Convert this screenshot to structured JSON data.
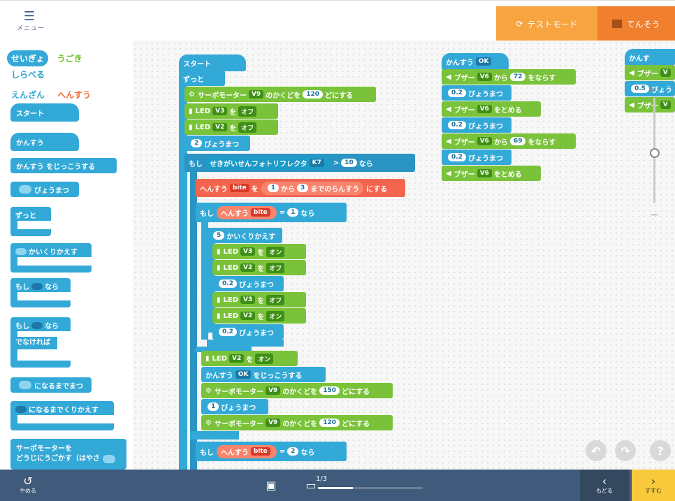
{
  "top": {
    "menu_label": "メニュー",
    "test_mode_label": "テストモード",
    "send_label": "てんそう"
  },
  "palette": {
    "tabs": [
      "せいぎょ",
      "うごき",
      "しらべる",
      "えんざん",
      "へんすう"
    ],
    "blocks": {
      "start": "スタート",
      "func": "かんすう",
      "call_func": "かんすう をじっこうする",
      "wait": "びょうまつ",
      "forever": "ずっと",
      "repeat": "かいくりかえす",
      "if_prefix": "もし",
      "if_suffix": "なら",
      "else": "でなければ",
      "wait_until": "になるまでまつ",
      "repeat_until": "になるまでくりかえす",
      "servo_speed_1": "サーボモーターを",
      "servo_speed_2": "どうじにうごかす（はやさ"
    }
  },
  "script": {
    "start": "スタート",
    "forever": "ずっと",
    "servo": "サーボモーター",
    "servo_port": "V9",
    "servo_mid": "のかくどを",
    "servo_suffix": "どにする",
    "servo_angle_1": "120",
    "led": "LED",
    "wo": "を",
    "v3": "V3",
    "v2": "V2",
    "off": "オフ",
    "on": "オン",
    "wait_1": "2",
    "wait": "びょうまつ",
    "if": "もし",
    "then": "なら",
    "sensor": "せきがいせんフォトリフレクタ",
    "sensor_port": "K7",
    "gt": ">",
    "eq": "=",
    "sensor_val": "10",
    "var": "へんすう",
    "var_name": "bite",
    "rand_1": "1",
    "rand_from": "から",
    "rand_2": "3",
    "rand_suffix": "までのらんすう",
    "set_suffix": "にする",
    "eq_val_1": "1",
    "repeat_n": "5",
    "repeat": "かいくりかえす",
    "wait_02": "0.2",
    "call": "かんすう",
    "func_name": "OK",
    "call_suffix": "をじっこうする",
    "servo_angle_2": "150",
    "wait_1s": "1",
    "eq_val_2": "2"
  },
  "func_ok": {
    "header": "かんすう",
    "name": "OK",
    "buzzer": "ブザー",
    "port": "V6",
    "from": "から",
    "play": "をならす",
    "stop": "をとめる",
    "note1": "72",
    "note2": "69",
    "wait_val": "0.2",
    "wait": "びょうまつ"
  },
  "func_right": {
    "header": "かんす",
    "buzzer": "ブザー",
    "port": "V",
    "wait_val": "0.5",
    "wait_text": "びょう"
  },
  "bottom": {
    "undo_label": "やめる",
    "page": "1/3",
    "progress": 0.33,
    "back_label": "もどる",
    "next_label": "すすむ"
  }
}
